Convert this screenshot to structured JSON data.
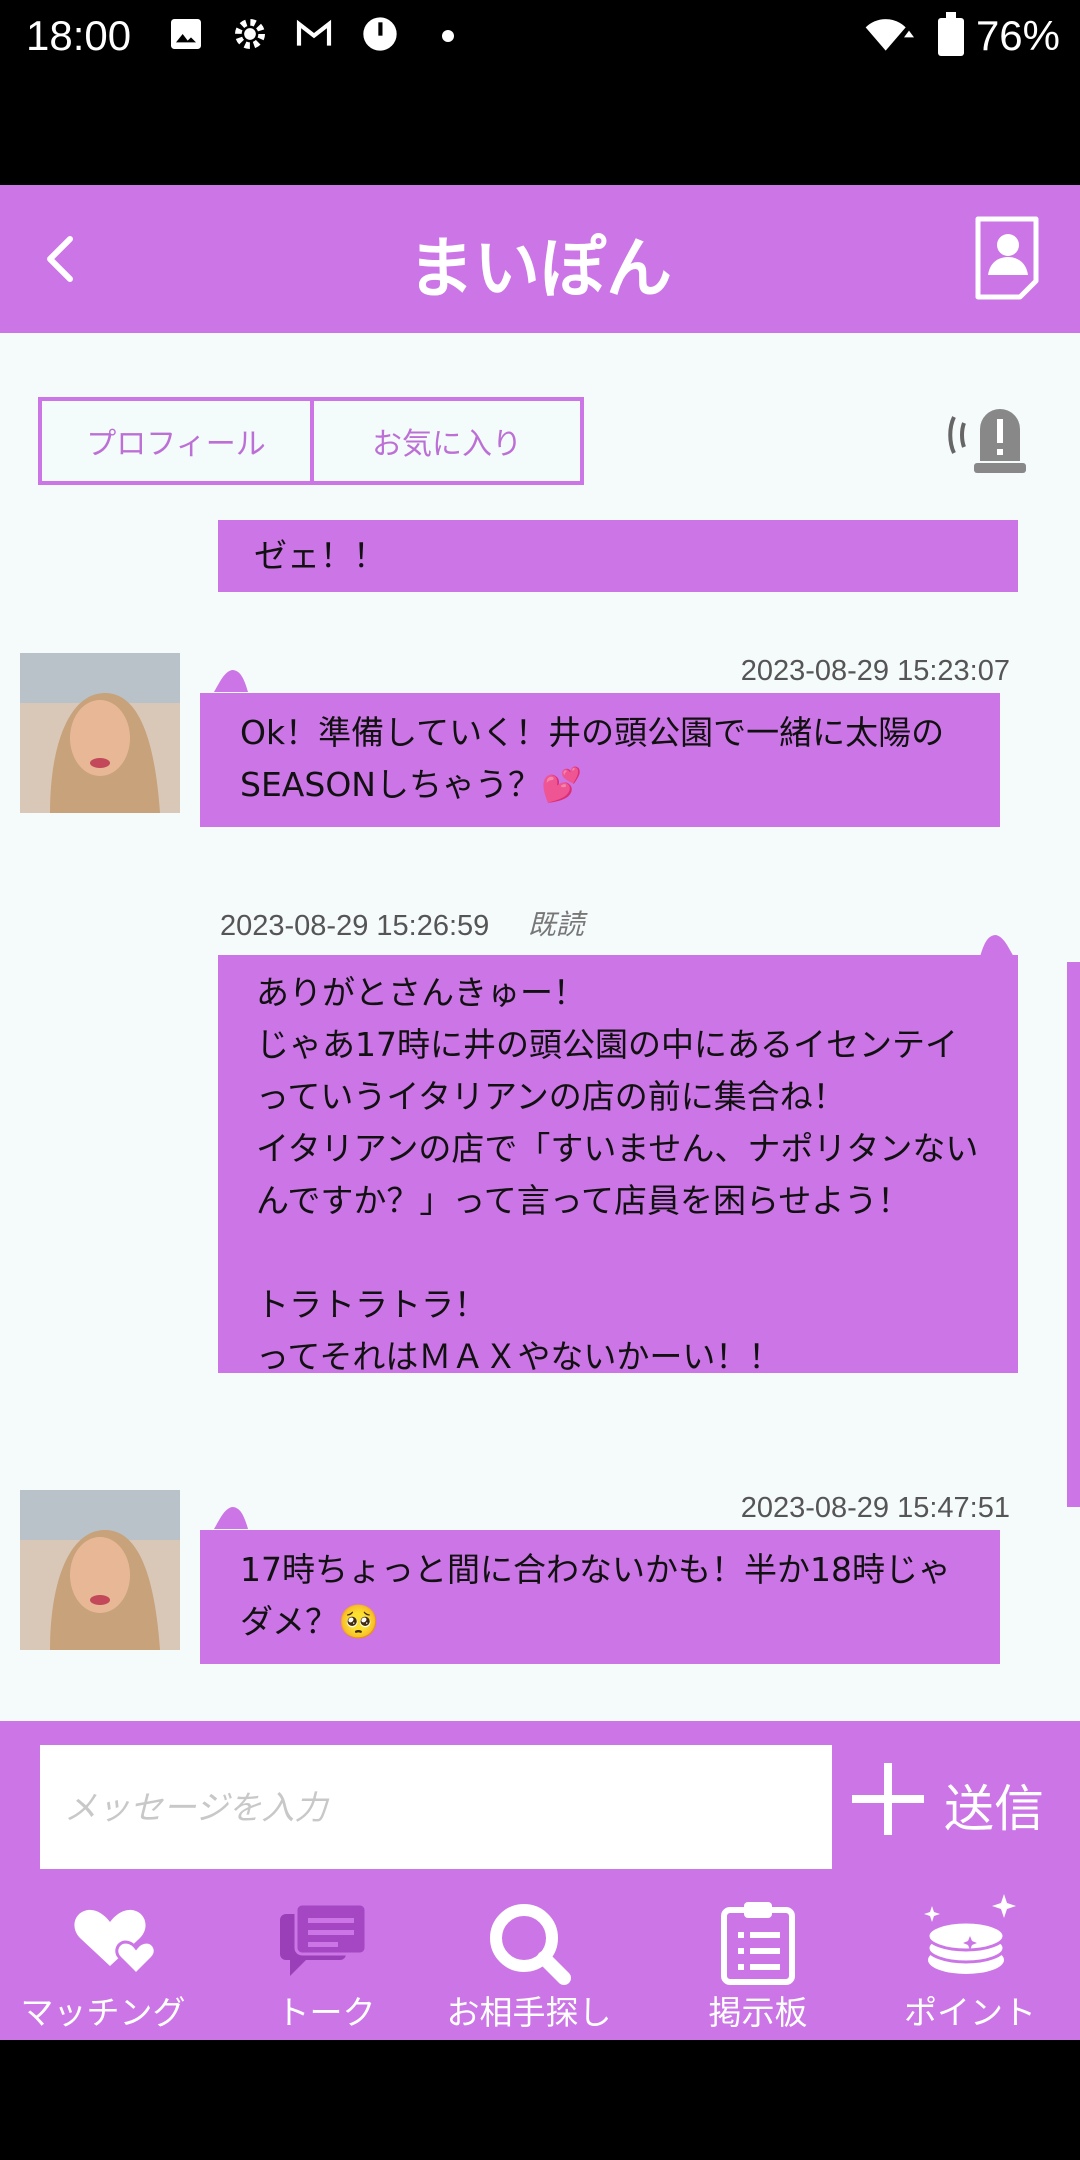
{
  "status_bar": {
    "time": "18:00",
    "battery": "76%",
    "icons": [
      "image-icon",
      "gear-icon",
      "gmail-icon",
      "alert-circle-icon",
      "dot-icon",
      "wifi-icon",
      "battery-icon"
    ]
  },
  "header": {
    "title": "まいぽん",
    "back_icon": "chevron-left-icon",
    "profile_icon": "profile-card-icon"
  },
  "tabs": {
    "profile_label": "プロフィール",
    "favorite_label": "お気に入り",
    "report_icon": "alarm-report-icon"
  },
  "messages": [
    {
      "side": "right",
      "text": "ゼェ！！"
    },
    {
      "side": "left",
      "timestamp": "2023-08-29 15:23:07",
      "text": "Ok！準備していく！井の頭公園で一緒に太陽のSEASONしちゃう？💕"
    },
    {
      "side": "right",
      "timestamp": "2023-08-29 15:26:59",
      "read": "既読",
      "text": "ありがとさんきゅー！\nじゃあ17時に井の頭公園の中にあるイセンテイっていうイタリアンの店の前に集合ね！\nイタリアンの店で「すいません、ナポリタンないんですか？」って言って店員を困らせよう！\n\nトラトラトラ！\nってそれはＭＡＸやないかーい！！"
    },
    {
      "side": "left",
      "timestamp": "2023-08-29 15:47:51",
      "text": "17時ちょっと間に合わないかも！半か18時じゃダメ？🥺"
    }
  ],
  "input": {
    "placeholder": "メッセージを入力",
    "send_label": "送信",
    "plus_icon": "plus-icon"
  },
  "nav": [
    {
      "label": "マッチング",
      "icon": "hearts-icon"
    },
    {
      "label": "トーク",
      "icon": "chat-bubbles-icon"
    },
    {
      "label": "お相手探し",
      "icon": "search-icon"
    },
    {
      "label": "掲示板",
      "icon": "clipboard-icon"
    },
    {
      "label": "ポイント",
      "icon": "coins-sparkle-icon"
    }
  ],
  "colors": {
    "accent": "#cb75e6",
    "background": "#f5fafa"
  }
}
